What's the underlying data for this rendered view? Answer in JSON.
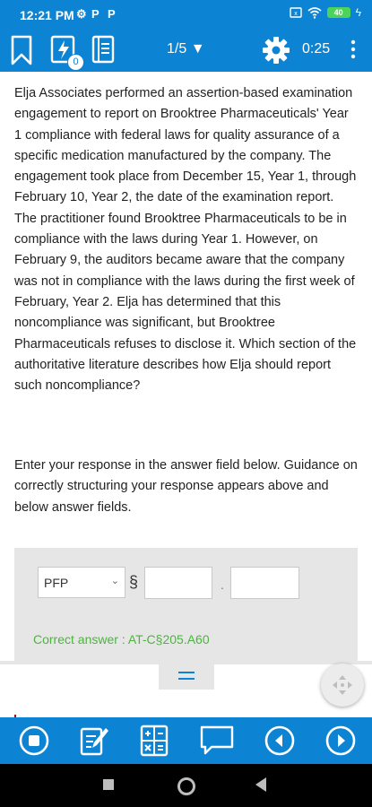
{
  "status_bar": {
    "time": "12:21 PM",
    "battery": "40"
  },
  "toolbar": {
    "badge_count": "0",
    "question_counter": "1/5",
    "timer": "0:25"
  },
  "question": {
    "text": "Elja Associates performed an assertion-based examination engagement to report on Brooktree Pharmaceuticals' Year 1 compliance with federal laws for quality assurance of a specific medication manufactured by the company.  The engagement took place from December 15, Year 1, through February 10, Year 2, the date of the examination report.  The practitioner found Brooktree Pharmaceuticals to be in compliance with the laws during Year 1.  However, on February 9, the auditors became aware that the company was not in compliance with the laws during the first week of February, Year 2.  Elja has determined that this noncompliance was significant, but Brooktree Pharmaceuticals refuses to disclose it.  Which section of the authoritative literature describes how Elja should report such noncompliance?",
    "instructions": "Enter your response in the answer field below. Guidance on correctly structuring your response appears above and below answer fields."
  },
  "answer": {
    "selected_source": "PFP",
    "section_symbol": "§",
    "separator": ".",
    "field1_value": "",
    "field2_value": "",
    "correct_answer": "Correct answer : AT-C§205.A60"
  },
  "colors": {
    "primary": "#0d84d3",
    "correct": "#4bb53d",
    "panel": "#e6e6e6"
  },
  "icons": [
    "bookmark-icon",
    "flash-card-icon",
    "notebook-icon",
    "dropdown-arrow-icon",
    "settings-gear-icon",
    "more-options-icon",
    "stop-icon",
    "edit-note-icon",
    "calculator-icon",
    "comment-icon",
    "previous-icon",
    "next-icon",
    "drag-handle-icon",
    "move-fab-icon"
  ]
}
